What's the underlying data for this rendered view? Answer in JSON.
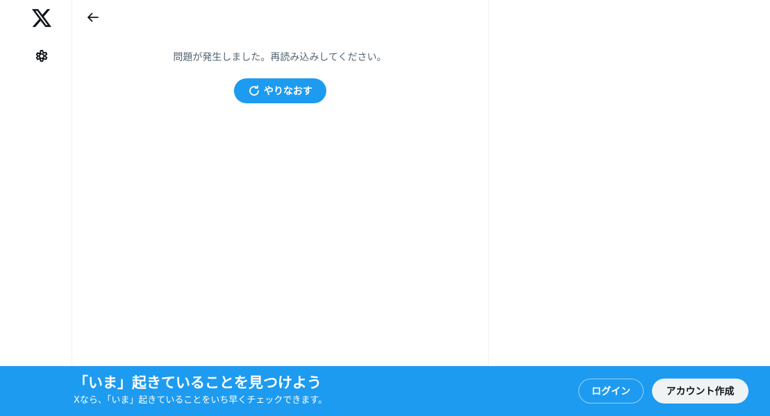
{
  "nav": {
    "logo_icon": "x-logo-icon",
    "settings_icon": "gear-icon"
  },
  "header": {
    "back_icon": "arrow-left-icon"
  },
  "main": {
    "error_message": "問題が発生しました。再読み込みしてください。",
    "retry_label": "やりなおす",
    "retry_icon": "refresh-icon"
  },
  "banner": {
    "title": "「いま」起きていることを見つけよう",
    "subtitle": "Xなら、「いま」起きていることをいち早くチェックできます。",
    "login_label": "ログイン",
    "signup_label": "アカウント作成"
  },
  "colors": {
    "accent": "#1d9bf0",
    "text_secondary": "#536471",
    "border": "#eff3f4"
  }
}
